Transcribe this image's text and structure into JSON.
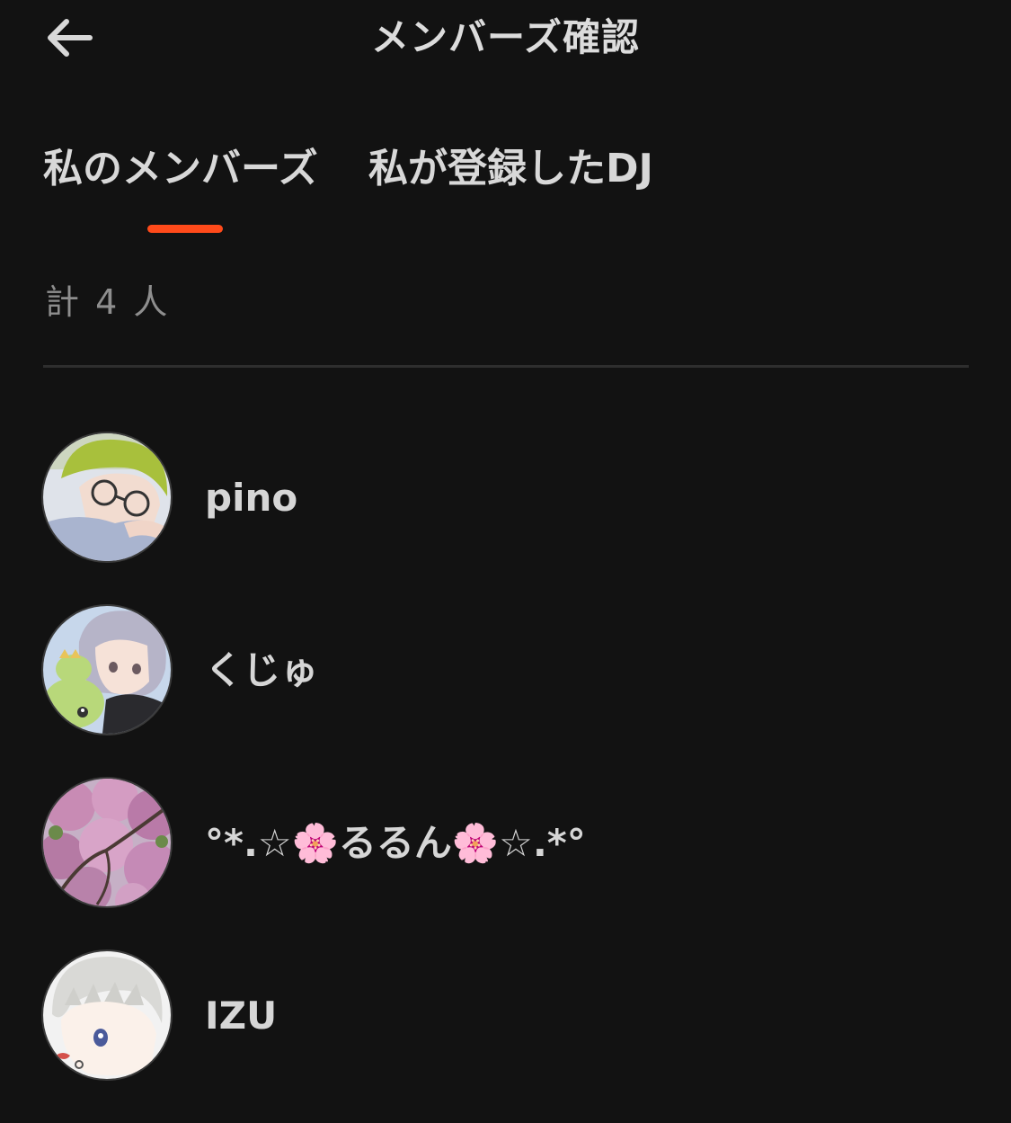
{
  "header": {
    "title": "メンバーズ確認",
    "back_icon": "arrow-left-icon"
  },
  "tabs": [
    {
      "label": "私のメンバーズ",
      "active": true
    },
    {
      "label": "私が登録したDJ",
      "active": false
    }
  ],
  "colors": {
    "background": "#121212",
    "accent": "#ff4a1a",
    "text": "#d6d6d6",
    "muted": "#8e8e8e"
  },
  "count_text": "計 4 人",
  "members": [
    {
      "name": "pino",
      "avatar": "green-hair-glasses-avatar"
    },
    {
      "name": "くじゅ",
      "avatar": "gray-hair-dinosaur-avatar"
    },
    {
      "name": "°*.☆🌸るるん🌸☆.*°",
      "avatar": "cherry-blossom-avatar"
    },
    {
      "name": "IZU",
      "avatar": "white-hair-avatar"
    }
  ]
}
